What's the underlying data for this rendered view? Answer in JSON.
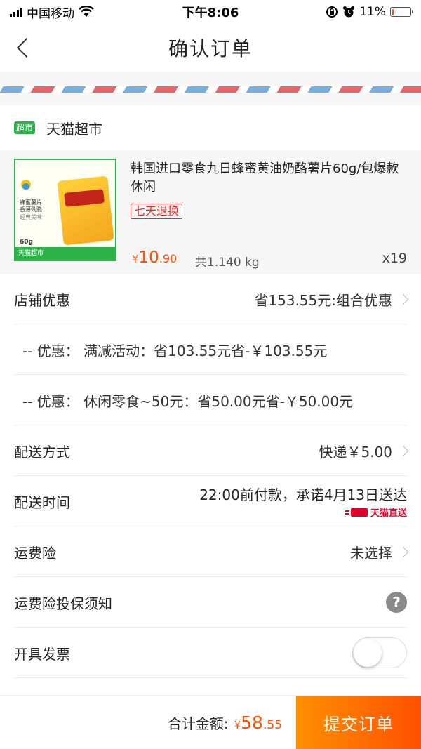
{
  "status_bar": {
    "carrier": "中国移动",
    "time": "下午8:06",
    "battery": "11%",
    "icons": [
      "signal-icon",
      "wifi-icon",
      "lock-rotation-icon",
      "alarm-icon",
      "battery-icon"
    ]
  },
  "nav": {
    "title": "确认订单",
    "back_icon": "chevron-left-icon"
  },
  "store": {
    "badge": "超市",
    "name": "天猫超市"
  },
  "product": {
    "name": "韩国进口零食九日蜂蜜黄油奶酪薯片60g/包爆款休闲",
    "tag": "七天退换",
    "price_symbol": "¥",
    "price_int": "10",
    "price_dec": ".90",
    "weight": "共1.140 kg",
    "quantity": "x19",
    "thumb_text_1": "蜂蜜薯片",
    "thumb_text_2": "香薄劲脆",
    "thumb_text_3": "经典美味",
    "thumb_weight": "60g",
    "thumb_footer": "天猫超市"
  },
  "rows": {
    "shop_discount": {
      "label": "店铺优惠",
      "value": "省153.55元:组合优惠"
    },
    "promo_1": {
      "text": "-- 优惠：  满减活动：省103.55元省-￥103.55元"
    },
    "promo_2": {
      "text": "-- 优惠：  休闲零食~50元：省50.00元省-￥50.00元"
    },
    "shipping": {
      "label": "配送方式",
      "value": "快递￥5.00"
    },
    "delivery_time": {
      "label": "配送时间",
      "value": "22:00前付款，承诺4月13日送达",
      "badge": "天猫直送"
    },
    "insurance": {
      "label": "运费险",
      "value": "未选择"
    },
    "insurance_notice": {
      "label": "运费险投保须知"
    },
    "invoice": {
      "label": "开具发票",
      "enabled": false
    }
  },
  "footer": {
    "total_label": "合计金额:",
    "currency": "¥",
    "total_int": "58",
    "total_dec": ".55",
    "submit_label": "提交订单"
  },
  "colors": {
    "accent": "#ff5000",
    "green": "#2db34a",
    "tmall_red": "#e0002c"
  }
}
